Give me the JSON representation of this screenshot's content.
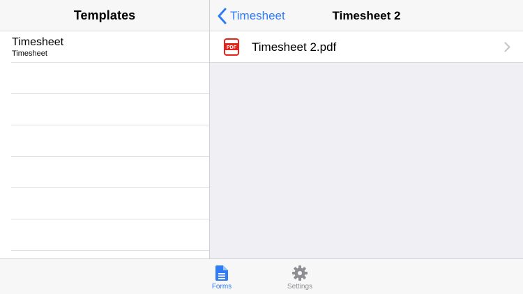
{
  "left_pane": {
    "title": "Templates",
    "items": [
      {
        "title": "Timesheet",
        "subtitle": "Timesheet"
      }
    ]
  },
  "right_pane": {
    "back_label": "Timesheet",
    "title": "Timesheet 2",
    "files": [
      {
        "name": "Timesheet 2.pdf",
        "icon": "pdf-icon"
      }
    ]
  },
  "tab_bar": {
    "tabs": [
      {
        "label": "Forms",
        "icon": "document-icon",
        "selected": true
      },
      {
        "label": "Settings",
        "icon": "gear-icon",
        "selected": false
      }
    ]
  },
  "colors": {
    "accent": "#2f7cf6",
    "pdf_red": "#e5231b",
    "inactive": "#8e8e93"
  }
}
